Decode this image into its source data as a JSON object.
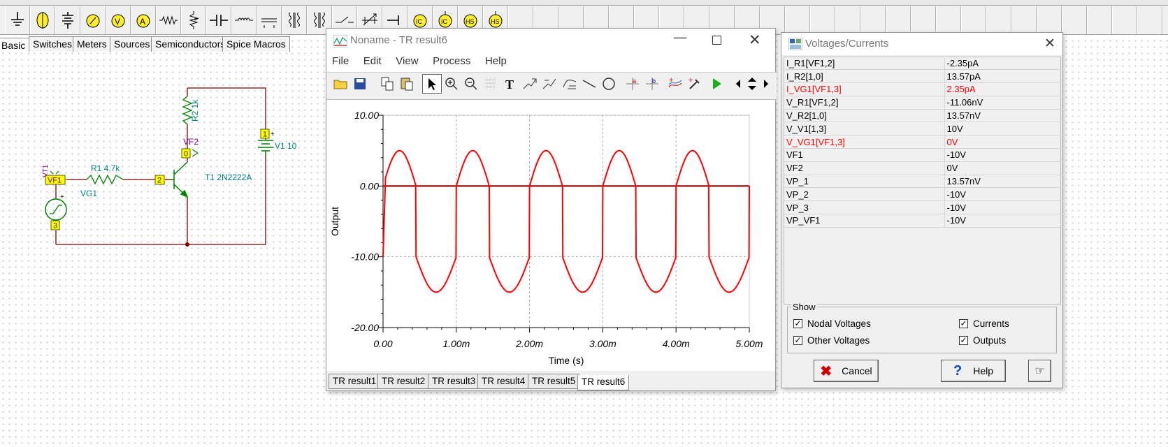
{
  "component_tabs": [
    "Basic",
    "Switches",
    "Meters",
    "Sources",
    "Semiconductors",
    "Spice Macros"
  ],
  "toolbar_icons": [
    "ground-icon",
    "voltage-source-icon",
    "battery-icon",
    "voltmeter-icon",
    "voltmeter-v-icon",
    "ammeter-icon",
    "resistor-icon",
    "potentiometer-icon",
    "capacitor-icon",
    "inductor-icon",
    "transformer-icon",
    "coupled-inductor-icon",
    "ideal-transformer-icon",
    "switch-icon",
    "variable-capacitor-icon",
    "terminal-icon",
    "ic-source-icon",
    "ic-source-alt-icon",
    "hs-source-icon",
    "hs-source-alt-icon"
  ],
  "schematic": {
    "r1": "R1 4.7k",
    "r2": "R2 1k",
    "v1": "V1 10",
    "vg1": "VG1",
    "t1": "T1 2N2222A",
    "vf1": "VF1",
    "vf2": "VF2",
    "node0": "0",
    "node1": "1",
    "node2": "2",
    "node3": "3",
    "plus1": "+",
    "plus2": "+",
    "vt1": "VT1"
  },
  "tr_window": {
    "title": "Noname - TR result6",
    "menu": [
      "File",
      "Edit",
      "View",
      "Process",
      "Help"
    ],
    "tabs": [
      "TR result1",
      "TR result2",
      "TR result3",
      "TR result4",
      "TR result5",
      "TR result6"
    ],
    "active_tab": "TR result6",
    "toolbar_icons": [
      "open-icon",
      "save-icon",
      "copy-icon",
      "paste-icon",
      "pointer-icon",
      "zoom-in-icon",
      "zoom-out-icon",
      "grid-icon",
      "text-icon",
      "cursor-a-icon",
      "cursor-b-icon",
      "curve-icon",
      "line-icon",
      "circle-icon",
      "marker-a-icon",
      "marker-b-icon",
      "waveform-icon",
      "probe-icon",
      "run-icon",
      "scroll-left-icon",
      "scroll-updown-icon",
      "scroll-right-icon"
    ]
  },
  "chart_data": {
    "type": "line",
    "xlabel": "Time (s)",
    "ylabel": "Output",
    "xlim": [
      0,
      0.005
    ],
    "ylim": [
      -20,
      10
    ],
    "x_ticks": [
      "0.00",
      "1.00m",
      "2.00m",
      "3.00m",
      "4.00m",
      "5.00m"
    ],
    "y_ticks": [
      "10.00",
      "0.00",
      "-10.00",
      "-20.00"
    ],
    "grid": true,
    "series": [
      {
        "color": "#ff0000",
        "shape": "clipped-sine",
        "frequency_hz": 1000,
        "offset": -5,
        "amplitude": 10,
        "x_values": [
          0,
          0.0002,
          0.00045,
          0.0007,
          0.00095,
          0.0012,
          0.00145,
          0.0017,
          0.002,
          0.005
        ],
        "y_values": [
          -10,
          5,
          -10,
          -15,
          -10,
          5,
          -10,
          -15,
          0,
          -10
        ]
      },
      {
        "color": "#a00000",
        "values_const": 0
      }
    ]
  },
  "vc_window": {
    "title": "Voltages/Currents",
    "rows": [
      {
        "name": "I_R1[VF1,2]",
        "value": "-2.35pA",
        "highlight": false
      },
      {
        "name": "I_R2[1,0]",
        "value": "13.57pA",
        "highlight": false
      },
      {
        "name": "I_VG1[VF1,3]",
        "value": "2.35pA",
        "highlight": true
      },
      {
        "name": "V_R1[VF1,2]",
        "value": "-11.06nV",
        "highlight": false
      },
      {
        "name": "V_R2[1,0]",
        "value": "13.57nV",
        "highlight": false
      },
      {
        "name": "V_V1[1,3]",
        "value": "10V",
        "highlight": false
      },
      {
        "name": "V_VG1[VF1,3]",
        "value": "0V",
        "highlight": true
      },
      {
        "name": "VF1",
        "value": "-10V",
        "highlight": false
      },
      {
        "name": "VF2",
        "value": "0V",
        "highlight": false
      },
      {
        "name": "VP_1",
        "value": "13.57nV",
        "highlight": false
      },
      {
        "name": "VP_2",
        "value": "-10V",
        "highlight": false
      },
      {
        "name": "VP_3",
        "value": "-10V",
        "highlight": false
      },
      {
        "name": "VP_VF1",
        "value": "-10V",
        "highlight": false
      }
    ],
    "show_group": "Show",
    "checkboxes": [
      {
        "label": "Nodal Voltages",
        "checked": true
      },
      {
        "label": "Currents",
        "checked": true
      },
      {
        "label": "Other Voltages",
        "checked": true
      },
      {
        "label": "Outputs",
        "checked": true
      }
    ],
    "cancel": "Cancel",
    "help": "Help"
  },
  "colors": {
    "accent_red": "#ff0000",
    "wire": "#800000",
    "component": "#008000",
    "label_teal": "#008080",
    "node_yellow": "#ffff00"
  }
}
